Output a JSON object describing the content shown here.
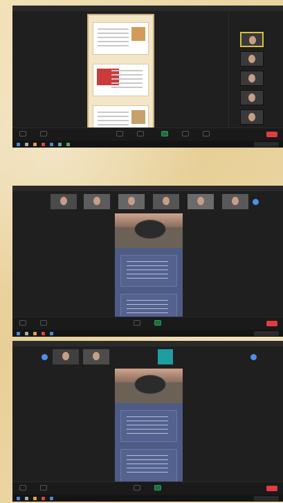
{
  "top_section": {},
  "middle_section": {},
  "bottom_section": {}
}
